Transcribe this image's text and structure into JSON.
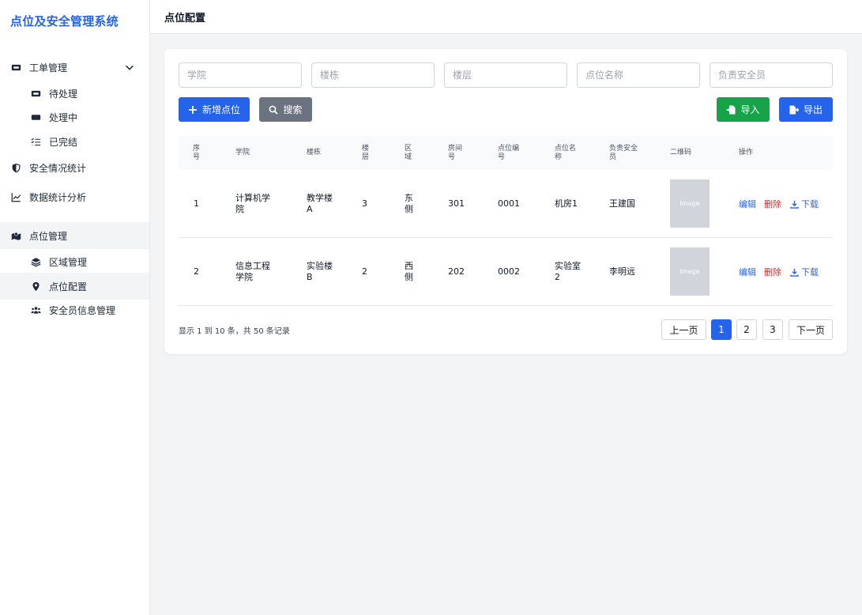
{
  "app": {
    "title": "点位及安全管理系统"
  },
  "header": {
    "page_title": "点位配置"
  },
  "sidebar": {
    "items": [
      {
        "label": "工单管理",
        "icon": "ticket-icon"
      },
      {
        "label": "待处理",
        "icon": "ticket-icon"
      },
      {
        "label": "处理中",
        "icon": "ticket-icon"
      },
      {
        "label": "已完结",
        "icon": "list-check-icon"
      },
      {
        "label": "安全情况统计",
        "icon": "shield-icon"
      },
      {
        "label": "数据统计分析",
        "icon": "chart-line-icon"
      },
      {
        "label": "点位管理",
        "icon": "map-icon"
      },
      {
        "label": "区域管理",
        "icon": "layers-icon"
      },
      {
        "label": "点位配置",
        "icon": "map-pin-icon"
      },
      {
        "label": "安全员信息管理",
        "icon": "users-icon"
      }
    ]
  },
  "filters": {
    "college_placeholder": "学院",
    "building_placeholder": "楼栋",
    "floor_placeholder": "楼层",
    "point_name_placeholder": "点位名称",
    "officer_placeholder": "负责安全员"
  },
  "toolbar": {
    "add_label": "新增点位",
    "search_label": "搜索",
    "import_label": "导入",
    "export_label": "导出"
  },
  "table": {
    "headers": {
      "index": "序\n号",
      "college": "学院",
      "building": "楼栋",
      "floor": "楼\n层",
      "area": "区\n域",
      "room": "房间\n号",
      "code": "点位编\n号",
      "name": "点位名\n称",
      "officer": "负责安全\n员",
      "qr": "二维码",
      "actions": "操作"
    },
    "rows": [
      {
        "index": "1",
        "college": "计算机学\n院",
        "building": "教学楼\nA",
        "floor": "3",
        "area": "东\n侧",
        "room": "301",
        "code": "0001",
        "name": "机房1",
        "officer": "王建国",
        "qr": "Image"
      },
      {
        "index": "2",
        "college": "信息工程\n学院",
        "building": "实验楼\nB",
        "floor": "2",
        "area": "西\n侧",
        "room": "202",
        "code": "0002",
        "name": "实验室\n2",
        "officer": "李明远",
        "qr": "Image"
      }
    ],
    "actions": {
      "edit": "编辑",
      "delete": "删除",
      "download": "下载"
    }
  },
  "pagination": {
    "summary": "显示 1 到 10 条，共 50 条记录",
    "prev": "上一页",
    "pages": [
      "1",
      "2",
      "3"
    ],
    "current": "1",
    "next": "下一页"
  },
  "colors": {
    "primary": "#2563eb",
    "success": "#16a34a",
    "danger": "#dc2626",
    "neutral": "#6b7280"
  }
}
